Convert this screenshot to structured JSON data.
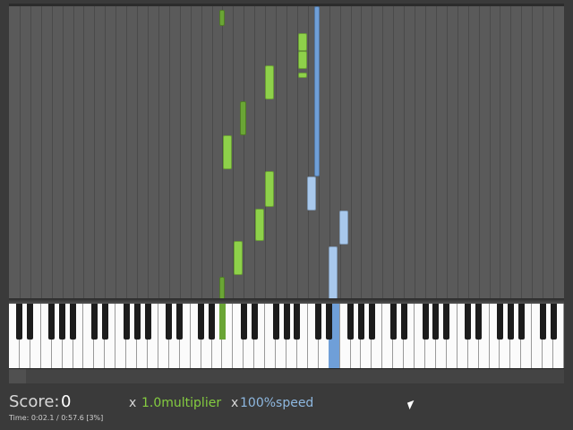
{
  "hud": {
    "score_label": "Score:",
    "score_value": "0",
    "multiplier_x": "x",
    "multiplier_value": "1.0multiplier",
    "speed_x": "x",
    "speed_value": "100%speed",
    "time_text": "Time:  0:02.1 / 0:57.6 [3%]"
  },
  "playback": {
    "progress_fraction": 0.03
  },
  "colors": {
    "green_note": "#8ed14a",
    "green_note_dark": "#6aa535",
    "blue_note": "#6f9fd8",
    "blue_note_light": "#a8c8ec",
    "lane_dark": "#4a4a4a",
    "field_bg": "#5a5a5a"
  },
  "icons": {
    "cursor": "mouse-pointer-icon"
  }
}
